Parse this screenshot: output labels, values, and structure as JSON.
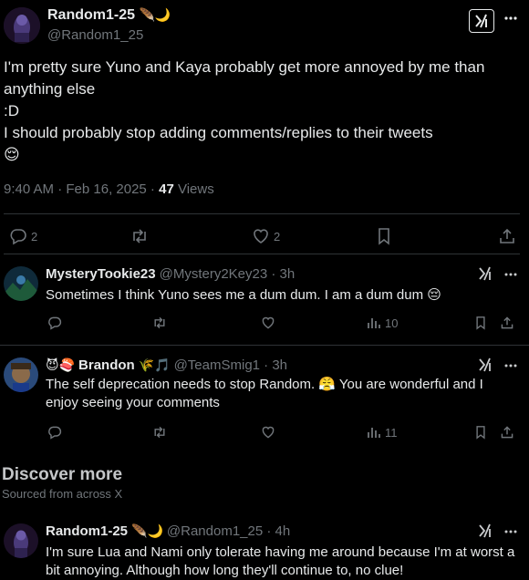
{
  "main_tweet": {
    "display_name": "Random1-25",
    "name_emoji": "🪶🌙",
    "handle": "@Random1_25",
    "body": "I'm pretty sure Yuno and Kaya probably get more annoyed by me than anything else\n:D\nI should probably stop adding comments/replies to their tweets\n😌",
    "time": "9:40 AM · Feb 16, 2025 · ",
    "views_count": "47",
    "views_label": " Views",
    "reply_count": "2",
    "like_count": "2"
  },
  "replies": [
    {
      "display_name": "MysteryTookie23",
      "handle_time": "@Mystery2Key23 · 3h",
      "body": "Sometimes I think Yuno sees me a dum dum. I am a dum dum 😔",
      "views": "10"
    },
    {
      "name_prefix": "😈🍣",
      "display_name": "Brandon",
      "name_suffix": "🌾🎵",
      "handle_time": "@TeamSmig1 · 3h",
      "body": "The self deprecation needs to stop Random. 😤 You are wonderful and I enjoy seeing your comments",
      "views": "11"
    }
  ],
  "discover": {
    "title": "Discover more",
    "subtitle": "Sourced from across X"
  },
  "discover_tweet": {
    "display_name": "Random1-25",
    "name_emoji": "🪶🌙",
    "handle_time": "@Random1_25 · 4h",
    "body": "I'm sure Lua and Nami only tolerate having me around because I'm at worst a bit annoying. Although how long they'll continue to, no clue!"
  },
  "colors": {
    "background": "#000000",
    "text": "#e7e9ea",
    "muted": "#71767b",
    "divider": "#2f3336"
  }
}
